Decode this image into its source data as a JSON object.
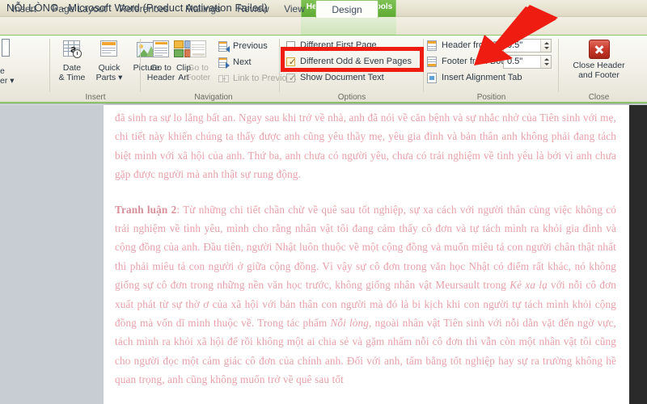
{
  "window": {
    "title": "NỖI LÒNG  -  Microsoft Word (Product Activation Failed)",
    "contextual_tools_label": "Header & Footer Tools"
  },
  "tabs": [
    {
      "label": "Insert",
      "active": false
    },
    {
      "label": "Page Layout",
      "active": false
    },
    {
      "label": "References",
      "active": false
    },
    {
      "label": "Mailings",
      "active": false
    },
    {
      "label": "Review",
      "active": false
    },
    {
      "label": "View",
      "active": false
    },
    {
      "label": "Design",
      "active": true
    }
  ],
  "ribbon": {
    "groups": [
      {
        "name": "Header & Footer",
        "label": ""
      },
      {
        "name": "Insert",
        "label": "Insert"
      },
      {
        "name": "Navigation",
        "label": "Navigation"
      },
      {
        "name": "Options",
        "label": "Options"
      },
      {
        "name": "Position",
        "label": "Position"
      },
      {
        "name": "Close",
        "label": "Close"
      }
    ],
    "cut_off_group": {
      "item1_label": "e",
      "item2_label": "er ▾"
    },
    "insert_group": {
      "buttons": [
        {
          "line1": "Date",
          "line2": "& Time",
          "icon": "date-and-time-icon",
          "disabled": false
        },
        {
          "line1": "Quick",
          "line2": "Parts ▾",
          "icon": "quick-parts-icon",
          "disabled": false
        },
        {
          "line1": "Picture",
          "line2": "",
          "icon": "picture-icon",
          "disabled": false
        },
        {
          "line1": "Clip",
          "line2": "Art",
          "icon": "clip-art-icon",
          "disabled": false
        }
      ]
    },
    "navigation_group": {
      "buttons": [
        {
          "line1": "Go to",
          "line2": "Header",
          "icon": "go-to-header-icon",
          "disabled": false
        },
        {
          "line1": "Go to",
          "line2": "Footer",
          "icon": "go-to-footer-icon",
          "disabled": true
        }
      ],
      "rows": [
        {
          "label": "Previous",
          "icon": "previous-section-icon",
          "disabled": false
        },
        {
          "label": "Next",
          "icon": "next-section-icon",
          "disabled": false
        },
        {
          "label": "Link to Previous",
          "icon": "link-to-previous-icon",
          "disabled": true
        }
      ]
    },
    "options_group": {
      "checkboxes": [
        {
          "label": "Different First Page",
          "checked": false,
          "greyed": false
        },
        {
          "label": "Different Odd & Even Pages",
          "checked": true,
          "greyed": false
        },
        {
          "label": "Show Document Text",
          "checked": true,
          "greyed": true
        }
      ]
    },
    "position_group": {
      "fields": [
        {
          "label": "Header from Top:",
          "value": "0.5\"",
          "icon": "header-from-top-icon"
        },
        {
          "label": "Footer from Bottom:",
          "value": "0.5\"",
          "icon": "footer-from-bottom-icon"
        }
      ],
      "action": {
        "label": "Insert Alignment Tab",
        "icon": "insert-alignment-tab-icon"
      }
    },
    "close_group": {
      "button": {
        "line1": "Close Header",
        "line2": "and Footer",
        "icon": "close-header-footer-icon"
      }
    }
  },
  "annotations": {
    "highlight_color": "#ee1c11",
    "arrow_color": "#ee1c11",
    "highlight_target": "Different Odd & Even Pages",
    "arrow_target": "Header from Top field"
  },
  "document": {
    "text_color": "#e8a0a8",
    "paragraphs": [
      {
        "lead_bold": "",
        "text": "đã sinh ra sự lo lắng bất an. Ngay sau khi trở về nhà, anh đã nói về căn bệnh và sự nhắc nhở của Tiên sinh với mẹ, chi tiết này khiến chúng ta thấy được anh cũng yêu thầy mẹ, yêu gia đình và bản thân anh không phải đang tách biệt mình với xã hội của anh. Thứ ba, anh chưa có người yêu, chưa có trải nghiệm về tình yêu là bởi vì anh chưa gặp được người mà anh thật sự rung động."
      },
      {
        "lead_bold": "Tranh luận 2",
        "text": ": Từ những chi tiết chần chừ về quê sau tốt nghiệp, sự xa cách với người thân cùng việc không có trải nghiệm về tình yêu, mình cho rằng nhân vật tôi đang cảm thấy cô đơn và tự tách mình ra khỏi gia đình và cộng đồng của anh. Đầu tiên, người Nhật luôn thuộc về một cộng đồng và muốn miêu tả con người chân thật nhất thì phải miêu tả con người ở giữa cộng đồng. Vì vậy sự cô đơn trong văn học Nhật có điểm rất khác, nó không giống sự cô đơn trong những nền văn học trước, không giống nhân vật Meursault trong ",
        "italic1": "Kẻ xa lạ",
        "text2": " với nỗi cô đơn xuất phát từ sự thờ ơ của xã hội với bản thân con người  mà đó là bi kịch khi con người tự tách mình khỏi cộng đồng mà vốn dĩ mình thuộc về. Trong tác phẩm ",
        "italic2": "Nỗi lòng",
        "text3": ", ngoài nhân vật Tiên sinh với nỗi dằn vặt đến ngờ vực, tách mình ra khỏi xã hội để rồi không một ai chia sẻ và gặm nhấm nỗi cô đơn thì vẫn còn một nhân vật tôi cũng cho người đọc một cảm giác cô đơn của chính anh. Đối với anh, tấm bằng tốt nghiệp hay sự ra trường không hề quan trọng, anh cũng không muốn trở về quê sau tốt"
      }
    ]
  }
}
